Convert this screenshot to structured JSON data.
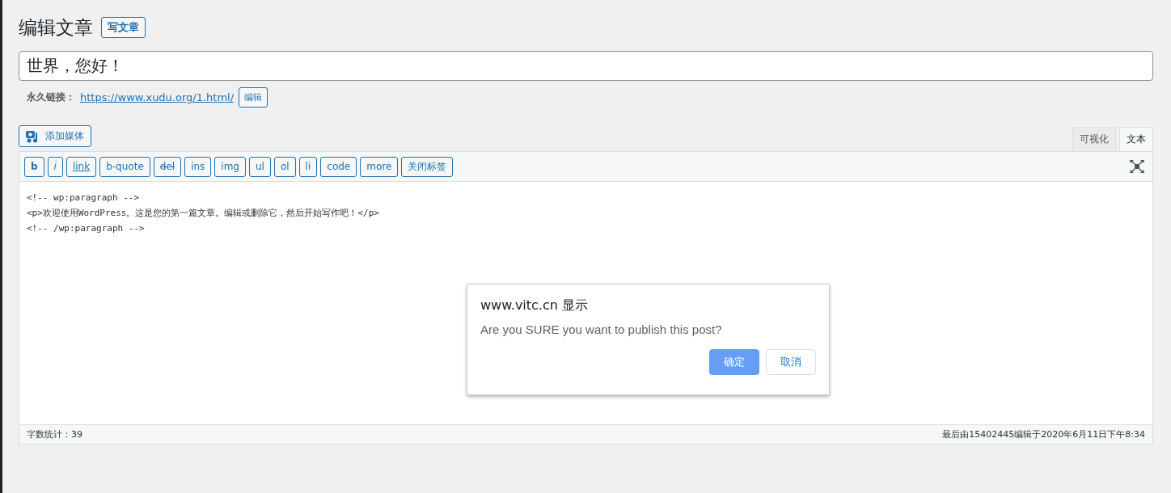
{
  "header": {
    "title": "编辑文章",
    "new_post_button": "写文章"
  },
  "post_title": {
    "value": "世界，您好！"
  },
  "permalink": {
    "label": "永久链接：",
    "url": "https://www.xudu.org/1.html/",
    "edit_button": "编辑"
  },
  "add_media_button": "添加媒体",
  "editor_tabs": [
    {
      "label": "可视化",
      "selected": false
    },
    {
      "label": "文本",
      "selected": true
    }
  ],
  "toolbar": [
    {
      "label": "b",
      "kind": "bold"
    },
    {
      "label": "i",
      "kind": "italic"
    },
    {
      "label": "link",
      "kind": "underline"
    },
    {
      "label": "b-quote",
      "kind": "plain"
    },
    {
      "label": "del",
      "kind": "strike"
    },
    {
      "label": "ins",
      "kind": "plain"
    },
    {
      "label": "img",
      "kind": "plain"
    },
    {
      "label": "ul",
      "kind": "plain"
    },
    {
      "label": "ol",
      "kind": "plain"
    },
    {
      "label": "li",
      "kind": "plain"
    },
    {
      "label": "code",
      "kind": "plain"
    },
    {
      "label": "more",
      "kind": "plain"
    },
    {
      "label": "关闭标签",
      "kind": "plain"
    }
  ],
  "content_lines": [
    "<!-- wp:paragraph -->",
    "<p>欢迎使用WordPress。这是您的第一篇文章。编辑或删除它，然后开始写作吧！</p>",
    "<!-- /wp:paragraph -->"
  ],
  "status_bar": {
    "word_count": "字数统计：39",
    "last_edited": "最后由15402445编辑于2020年6月11日下午8:34"
  },
  "dialog": {
    "title": "www.vitc.cn 显示",
    "message": "Are you SURE you want to publish this post?",
    "buttons": [
      {
        "label": "确定",
        "kind": "primary"
      },
      {
        "label": "取消",
        "kind": "secondary"
      }
    ]
  }
}
